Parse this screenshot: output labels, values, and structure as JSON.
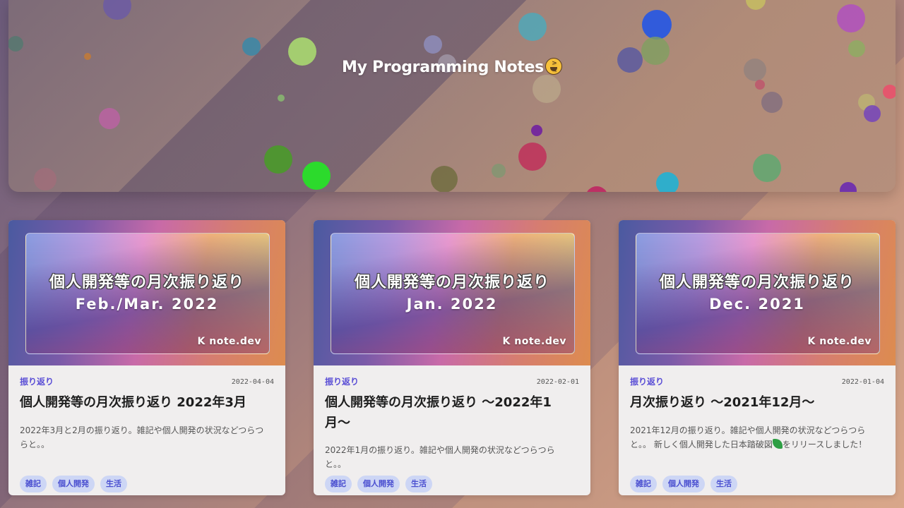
{
  "site": {
    "title": "My Programming Notes",
    "title_emoji": "laughing-face-emoji"
  },
  "colors": {
    "accent": "#5b4fd6",
    "tag_bg": "#cdd6f5",
    "tag_text": "#4a4fd0"
  },
  "cards": [
    {
      "thumb_title": "個人開発等の月次振り返り",
      "thumb_sub": "Feb./Mar. 2022",
      "thumb_brand": "K note.dev",
      "category": "振り返り",
      "date": "2022-04-04",
      "title": "個人開発等の月次振り返り 2022年3月",
      "excerpt": "2022年3月と2月の振り返り。雑記や個人開発の状況などつらつらと。。",
      "tags": [
        "雑記",
        "個人開発",
        "生活"
      ]
    },
    {
      "thumb_title": "個人開発等の月次振り返り",
      "thumb_sub": "Jan. 2022",
      "thumb_brand": "K note.dev",
      "category": "振り返り",
      "date": "2022-02-01",
      "title": "個人開発等の月次振り返り 〜2022年1月〜",
      "excerpt": "2022年1月の振り返り。雑記や個人開発の状況などつらつらと。。",
      "tags": [
        "雑記",
        "個人開発",
        "生活"
      ]
    },
    {
      "thumb_title": "個人開発等の月次振り返り",
      "thumb_sub": "Dec. 2021",
      "thumb_brand": "K note.dev",
      "category": "振り返り",
      "date": "2022-01-04",
      "title": "月次振り返り 〜2021年12月〜",
      "excerpt": "2021年12月の振り返り。雑記や個人開発の状況などつらつらと。。 新しく個人開発した日本踏破図",
      "excerpt_tail": "をリリースしました！",
      "excerpt_icon": "caterpillar-icon",
      "tags": [
        "雑記",
        "個人開発",
        "生活"
      ]
    }
  ]
}
